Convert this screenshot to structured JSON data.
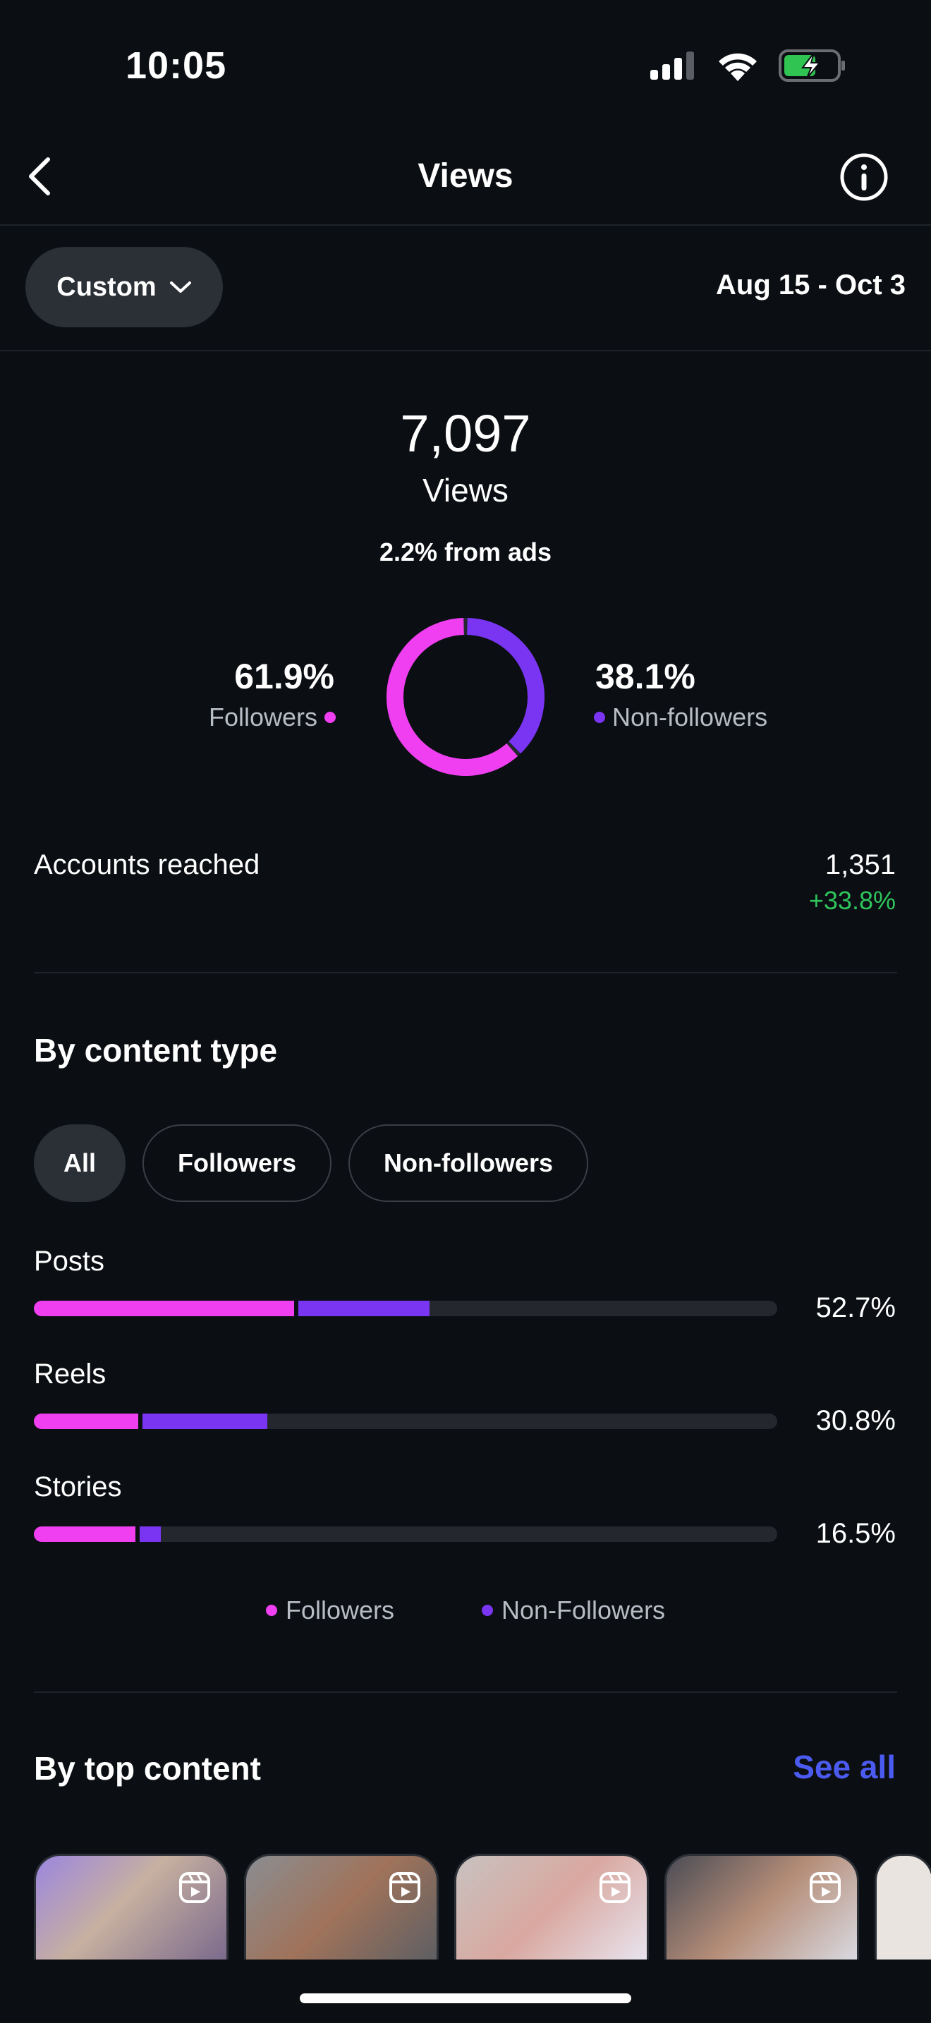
{
  "status_bar": {
    "time": "10:05"
  },
  "header": {
    "title": "Views"
  },
  "filter": {
    "period_label": "Custom",
    "date_range": "Aug 15 - Oct 3"
  },
  "summary": {
    "total": "7,097",
    "total_label": "Views",
    "ads_note": "2.2% from ads",
    "followers_pct": "61.9%",
    "followers_label": "Followers",
    "nonfollowers_pct": "38.1%",
    "nonfollowers_label": "Non-followers",
    "followers_share": 0.619,
    "nonfollowers_share": 0.381
  },
  "accounts_reached": {
    "label": "Accounts reached",
    "value": "1,351",
    "change": "+33.8%"
  },
  "by_content_type": {
    "title": "By content type",
    "tabs": [
      "All",
      "Followers",
      "Non-followers"
    ],
    "rows": [
      {
        "label": "Posts",
        "pct": "52.7%",
        "followers_share": 0.35,
        "nonfollowers_share": 0.177
      },
      {
        "label": "Reels",
        "pct": "30.8%",
        "followers_share": 0.14,
        "nonfollowers_share": 0.168
      },
      {
        "label": "Stories",
        "pct": "16.5%",
        "followers_share": 0.137,
        "nonfollowers_share": 0.028
      }
    ],
    "legend": [
      "Followers",
      "Non-Followers"
    ]
  },
  "by_top_content": {
    "title": "By top content",
    "see_all": "See all"
  },
  "colors": {
    "followers": "#f03ff0",
    "non_followers": "#7a35f3",
    "positive": "#2fc55c",
    "link": "#4b5bf0"
  }
}
